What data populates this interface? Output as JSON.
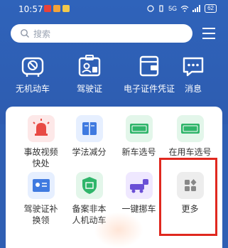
{
  "status_bar": {
    "time": "10:57",
    "signal_text": "5G",
    "battery": "62"
  },
  "search": {
    "placeholder": "搜索"
  },
  "quick_actions": [
    {
      "label": "无机动车",
      "icon": "car-icon"
    },
    {
      "label": "驾驶证",
      "icon": "license-icon"
    },
    {
      "label": "电子证件凭证",
      "icon": "wallet-icon"
    },
    {
      "label": "消息",
      "icon": "message-icon"
    }
  ],
  "services": [
    {
      "label": "事故视频",
      "label2": "快处",
      "icon": "siren-icon",
      "color": "#fde8e8"
    },
    {
      "label": "学法减分",
      "label2": "",
      "icon": "book-icon",
      "color": "#e6efff"
    },
    {
      "label": "新车选号",
      "label2": "",
      "icon": "new-plate-icon",
      "color": "#e3f6ea"
    },
    {
      "label": "在用车选号",
      "label2": "",
      "icon": "used-plate-icon",
      "color": "#e3f6ea"
    },
    {
      "label": "驾驶证补",
      "label2": "换领",
      "icon": "license-renew-icon",
      "color": "#e6efff"
    },
    {
      "label": "备案非本",
      "label2": "人机动车",
      "icon": "record-icon",
      "color": "#e3f6ea"
    },
    {
      "label": "一键挪车",
      "label2": "",
      "icon": "tow-truck-icon",
      "color": "#efe8ff"
    },
    {
      "label": "更多",
      "label2": "",
      "icon": "more-grid-icon",
      "color": "#ededed"
    }
  ]
}
